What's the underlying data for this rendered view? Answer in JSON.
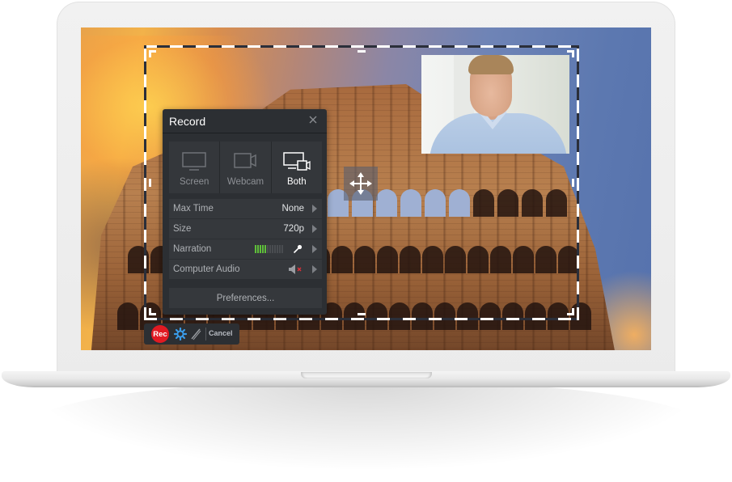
{
  "record_panel": {
    "title": "Record",
    "close_icon": "close-icon",
    "modes": [
      {
        "label": "Screen",
        "icon": "monitor-icon",
        "active": false
      },
      {
        "label": "Webcam",
        "icon": "webcam-icon",
        "active": false
      },
      {
        "label": "Both",
        "icon": "monitor-webcam-icon",
        "active": true
      }
    ],
    "settings": [
      {
        "key": "Max Time",
        "value": "None"
      },
      {
        "key": "Size",
        "value": "720p"
      },
      {
        "key": "Narration",
        "value": "",
        "meter_level": 0.42,
        "icon": "microphone-icon"
      },
      {
        "key": "Computer Audio",
        "value": "",
        "icon": "speaker-muted-icon"
      }
    ],
    "preferences_label": "Preferences..."
  },
  "toolbar": {
    "rec_label": "Rec",
    "settings_icon": "gear-icon",
    "draw_icon": "pencil-icon",
    "cancel_label": "Cancel"
  },
  "colors": {
    "panel_bg": "#2c2f33",
    "rec_red": "#e11a22",
    "meter_green": "#5fbf3a",
    "mute_red": "#e0303a",
    "gear_blue": "#3a9be8"
  }
}
